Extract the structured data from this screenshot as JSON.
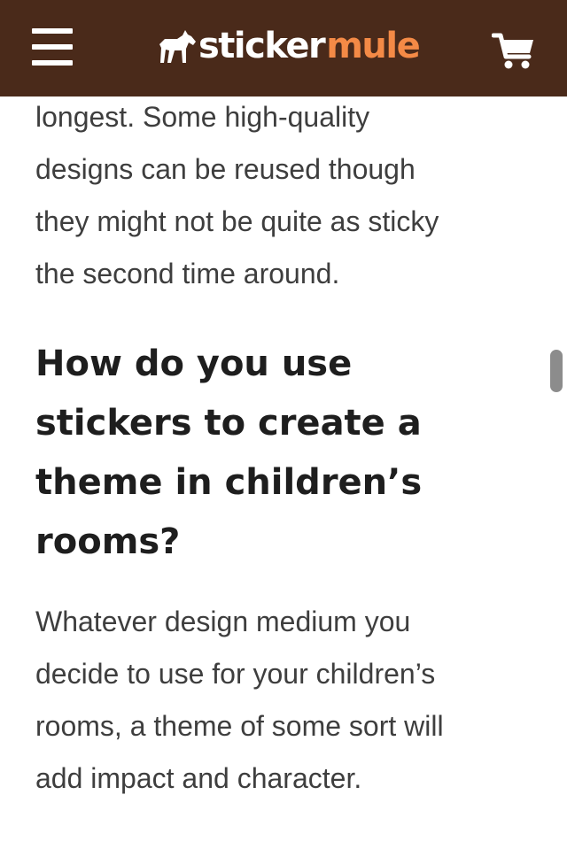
{
  "header": {
    "brand_part1": "sticker",
    "brand_part2": "mule",
    "icons": {
      "menu": "hamburger-menu-icon",
      "logo": "mule-logo-icon",
      "cart": "shopping-cart-icon"
    },
    "colors": {
      "background": "#4a2a1a",
      "brand_accent": "#f48a46"
    }
  },
  "article": {
    "intro_lines": [
      "longest. Some high-quality",
      "designs can be reused though",
      "they might not be quite as sticky",
      "the second time around."
    ],
    "heading_lines": [
      "How do you use",
      "stickers to create a",
      "theme in children’s",
      "rooms?"
    ],
    "body_lines": [
      "Whatever design medium you",
      "decide to use for your children’s",
      "rooms, a theme of some sort will",
      "add impact and character."
    ]
  }
}
